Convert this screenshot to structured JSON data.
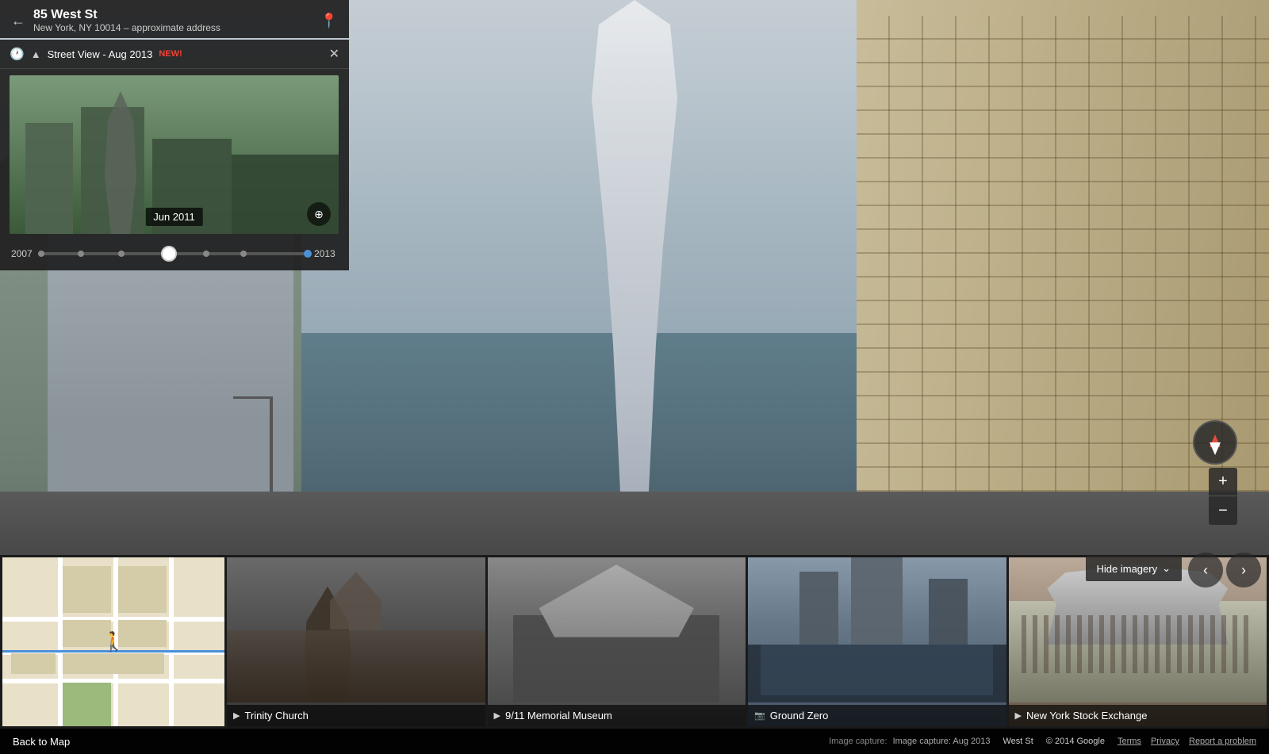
{
  "address": {
    "title": "85 West St",
    "subtitle": "New York, NY 10014 – approximate address"
  },
  "streetview": {
    "header": "Street View - Aug 2013",
    "new_badge": "NEW!",
    "thumb_date": "Jun 2011",
    "timeline_start": "2007",
    "timeline_end": "2013"
  },
  "controls": {
    "zoom_in": "+",
    "zoom_out": "−",
    "hide_imagery": "Hide imagery",
    "back_to_map": "Back to Map"
  },
  "thumbnails": [
    {
      "label": "Trinity Church",
      "type": "church",
      "icon": "▶"
    },
    {
      "label": "9/11 Memorial Museum",
      "type": "memorial",
      "icon": "▶"
    },
    {
      "label": "Ground Zero",
      "type": "gzero",
      "icon": "📷"
    },
    {
      "label": "New York Stock Exchange",
      "type": "nyse",
      "icon": "▶"
    }
  ],
  "footer": {
    "capture_info": "Image capture: Aug 2013",
    "street": "West St",
    "copyright": "© 2014 Google",
    "terms": "Terms",
    "privacy": "Privacy",
    "report": "Report a problem"
  }
}
